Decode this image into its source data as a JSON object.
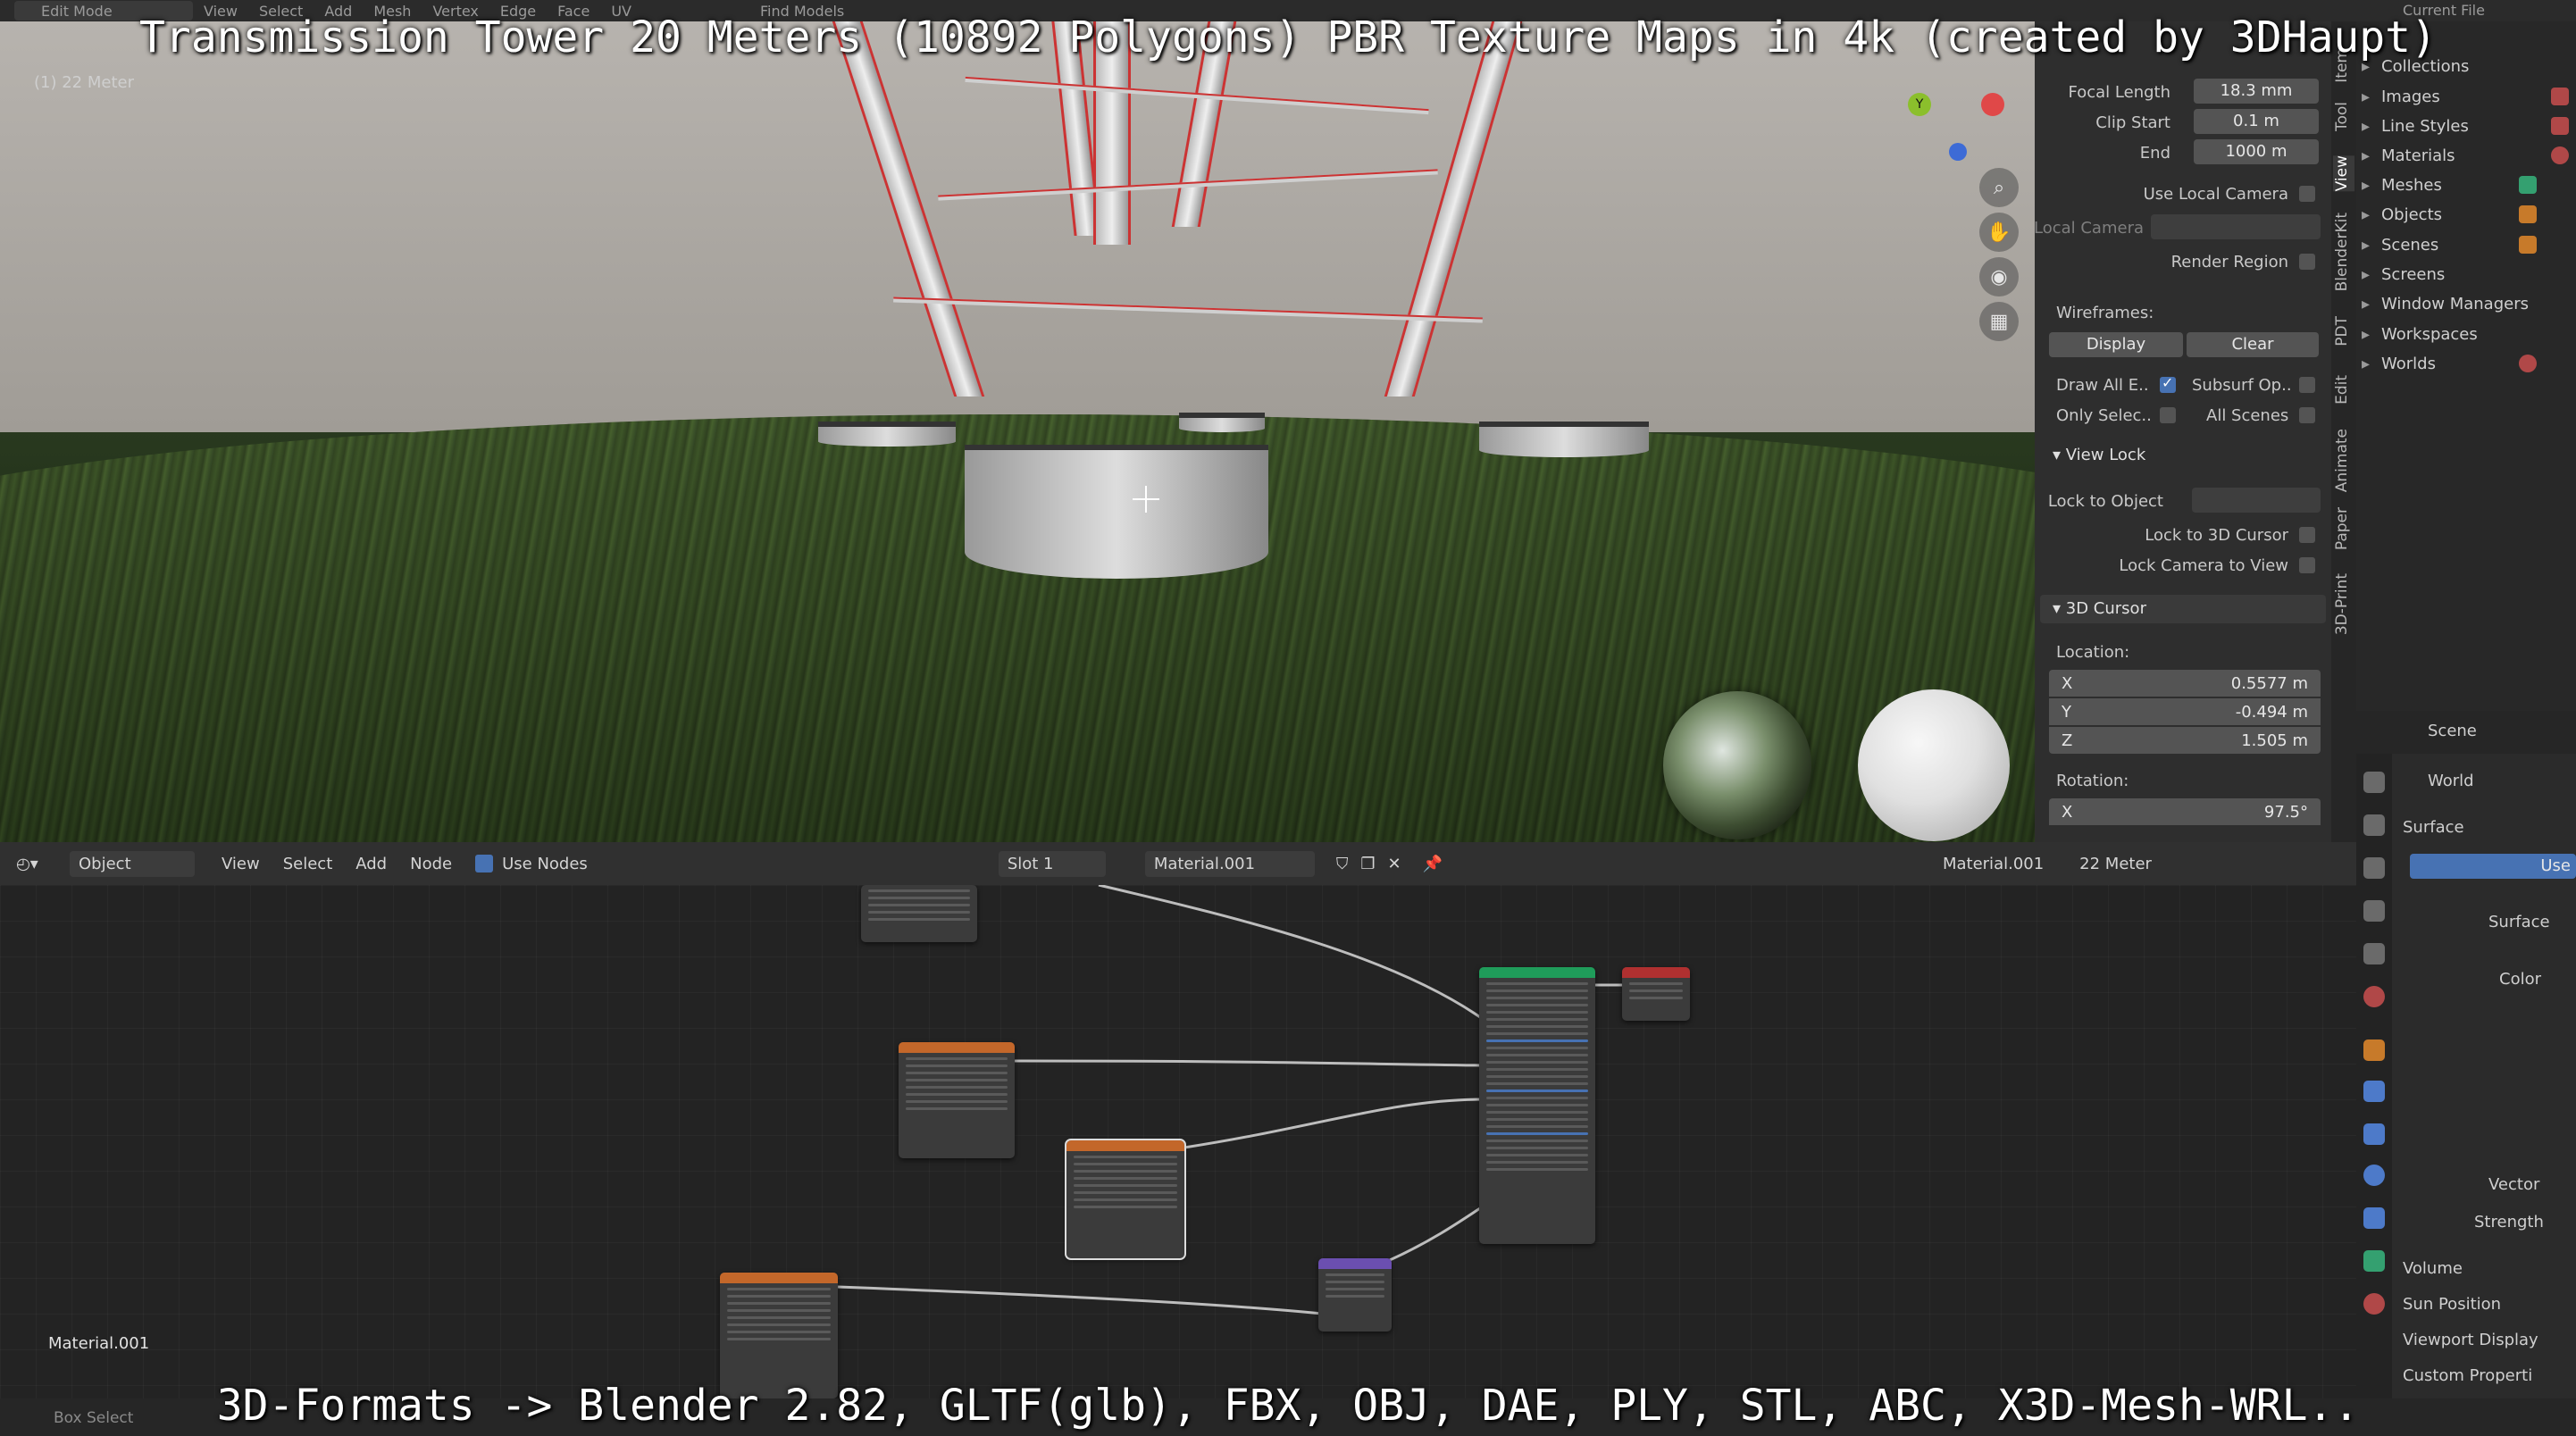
{
  "overlay": {
    "title": "Transmission Tower 20 Meters (10892 Polygons) PBR Texture Maps in 4k (created by 3DHaupt)",
    "bottom": "3D-Formats -> Blender 2.82, GLTF(glb), FBX, OBJ, DAE, PLY, STL, ABC, X3D-Mesh-WRL.."
  },
  "topbar": {
    "mode": "Edit Mode",
    "menus": [
      "View",
      "Select",
      "Add",
      "Mesh",
      "Vertex",
      "Edge",
      "Face",
      "UV"
    ],
    "find": "Find Models",
    "current": "Current File"
  },
  "viewport": {
    "label": "(1) 22 Meter",
    "gizmo_y": "Y"
  },
  "vtabs": [
    "Item",
    "Tool",
    "View",
    "BlenderKit",
    "PDT",
    "Edit",
    "Animate",
    "Paper",
    "3D-Print"
  ],
  "npanel": {
    "focal_length_label": "Focal Length",
    "focal_length": "18.3 mm",
    "clip_start_label": "Clip Start",
    "clip_start": "0.1 m",
    "end_label": "End",
    "end": "1000 m",
    "use_local_camera": "Use Local Camera",
    "local_camera": "Local Camera",
    "render_region": "Render Region",
    "wireframes": "Wireframes:",
    "display": "Display",
    "clear": "Clear",
    "draw_all": "Draw All E..",
    "subsurf": "Subsurf Op..",
    "only_selected": "Only Selec..",
    "all_scenes": "All Scenes",
    "view_lock": "View Lock",
    "lock_to_object": "Lock to Object",
    "lock_3d_cursor": "Lock to 3D Cursor",
    "lock_camera": "Lock Camera to View",
    "cursor_section": "3D Cursor",
    "location": "Location:",
    "loc": [
      {
        "ax": "X",
        "val": "0.5577 m"
      },
      {
        "ax": "Y",
        "val": "-0.494 m"
      },
      {
        "ax": "Z",
        "val": "1.505 m"
      }
    ],
    "rotation": "Rotation:",
    "rot_x_ax": "X",
    "rot_x": "97.5°"
  },
  "outliner": {
    "items": [
      "Collections",
      "Images",
      "Line Styles",
      "Materials",
      "Meshes",
      "Objects",
      "Scenes",
      "Screens",
      "Window Managers",
      "Workspaces",
      "Worlds"
    ]
  },
  "properties": {
    "scene": "Scene",
    "world": "World",
    "surface_section": "Surface",
    "use": "Use",
    "surface": "Surface",
    "color": "Color",
    "vector": "Vector",
    "strength": "Strength",
    "volume": "Volume",
    "sun_position": "Sun Position",
    "viewport_display": "Viewport Display",
    "custom_properties": "Custom Properti"
  },
  "node_header": {
    "object": "Object",
    "view": "View",
    "select": "Select",
    "add": "Add",
    "node": "Node",
    "use_nodes": "Use Nodes",
    "slot": "Slot 1",
    "material": "Material.001",
    "breadcrumb_material": "Material.001",
    "breadcrumb_object": "22 Meter"
  },
  "node_editor": {
    "material_label": "Material.001"
  },
  "statusbar": {
    "box_select": "Box Select"
  },
  "colors": {
    "accent": "#4772b3",
    "shader_node_header": "#1f9c5a",
    "texture_node_header": "#c3672a",
    "vector_node_header": "#6b4fb0",
    "output_node_header": "#b03030"
  }
}
